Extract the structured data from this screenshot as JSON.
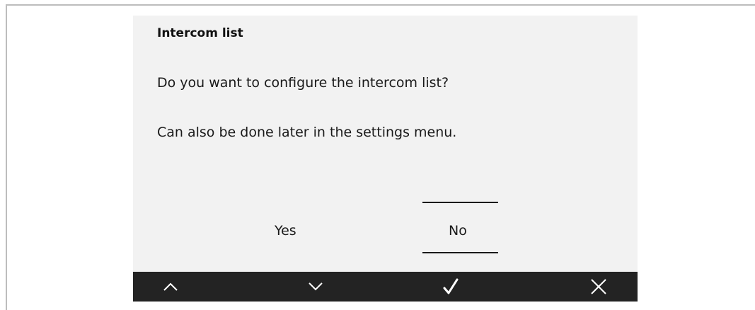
{
  "dialog": {
    "title": "Intercom list",
    "question": "Do you want to configure the intercom list?",
    "hint": "Can also be done later in the settings menu."
  },
  "options": {
    "yes_label": "Yes",
    "no_label": "No",
    "selected": "No"
  },
  "toolbar": {
    "buttons": [
      {
        "name": "up",
        "icon": "chevron-up-icon"
      },
      {
        "name": "down",
        "icon": "chevron-down-icon"
      },
      {
        "name": "confirm",
        "icon": "checkmark-icon"
      },
      {
        "name": "cancel",
        "icon": "close-icon"
      }
    ],
    "background": "#232323",
    "icon_color": "#ffffff"
  },
  "colors": {
    "screen_background": "#f2f2f2",
    "text": "#1a1a1a"
  }
}
